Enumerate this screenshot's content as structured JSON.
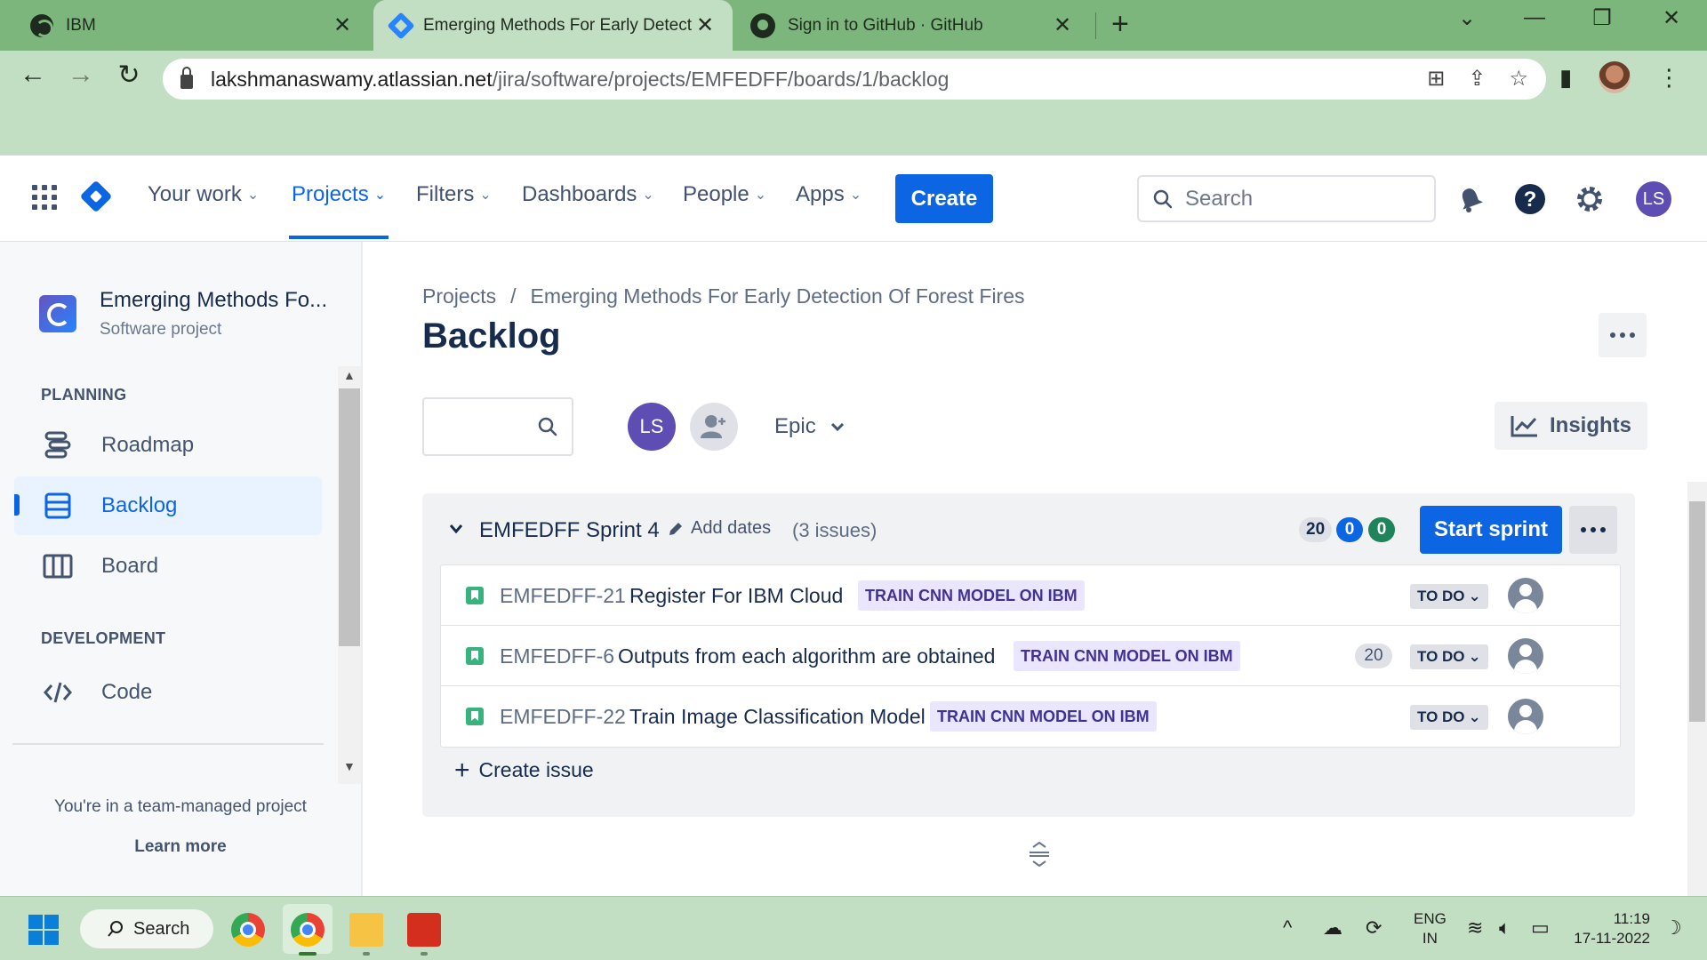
{
  "browser": {
    "tabs": [
      {
        "title": "IBM",
        "icon": "ibm-favicon"
      },
      {
        "title": "Emerging Methods For Early Detecti",
        "icon": "jira-favicon",
        "active": true
      },
      {
        "title": "Sign in to GitHub · GitHub",
        "icon": "github-favicon"
      }
    ],
    "url_host": "lakshmanaswamy.atlassian.net",
    "url_path": "/jira/software/projects/EMFEDFF/boards/1/backlog"
  },
  "jira_nav": {
    "items": [
      {
        "label": "Your work"
      },
      {
        "label": "Projects",
        "active": true
      },
      {
        "label": "Filters"
      },
      {
        "label": "Dashboards"
      },
      {
        "label": "People"
      },
      {
        "label": "Apps"
      }
    ],
    "create_label": "Create",
    "search_placeholder": "Search",
    "avatar_initials": "LS"
  },
  "sidebar": {
    "project_name": "Emerging Methods Fo...",
    "project_type": "Software project",
    "planning_label": "PLANNING",
    "development_label": "DEVELOPMENT",
    "items": [
      {
        "label": "Roadmap"
      },
      {
        "label": "Backlog",
        "active": true
      },
      {
        "label": "Board"
      },
      {
        "label": "Code"
      }
    ],
    "team_note": "You're in a team-managed project",
    "learn_more": "Learn more"
  },
  "main": {
    "breadcrumb": [
      "Projects",
      "/",
      "Emerging Methods For Early Detection Of Forest Fires"
    ],
    "title": "Backlog",
    "filter_avatar": "LS",
    "epic_label": "Epic",
    "insights_label": "Insights",
    "sprint": {
      "name": "EMFEDFF Sprint 4",
      "add_dates": "Add dates",
      "issue_count": "(3 issues)",
      "points_todo": "20",
      "points_inprogress": "0",
      "points_done": "0",
      "start_label": "Start sprint",
      "issues": [
        {
          "key": "EMFEDFF-21",
          "summary": "Register For IBM Cloud",
          "epic": "TRAIN CNN MODEL ON IBM",
          "estimate": "",
          "status": "TO DO"
        },
        {
          "key": "EMFEDFF-6",
          "summary": "Outputs from each algorithm are obtained",
          "epic": "TRAIN CNN MODEL ON IBM",
          "estimate": "20",
          "status": "TO DO"
        },
        {
          "key": "EMFEDFF-22",
          "summary": "Train Image Classification Model",
          "epic": "TRAIN CNN MODEL ON IBM",
          "estimate": "",
          "status": "TO DO"
        }
      ]
    },
    "create_issue": "Create issue"
  },
  "taskbar": {
    "search_label": "Search",
    "lang_top": "ENG",
    "lang_bottom": "IN",
    "time": "11:19",
    "date": "17-11-2022"
  },
  "colors": {
    "brand_blue": "#0c66e4",
    "epic_bg": "#eae6ff",
    "epic_text": "#403294",
    "chrome_green": "#7cb67c"
  }
}
